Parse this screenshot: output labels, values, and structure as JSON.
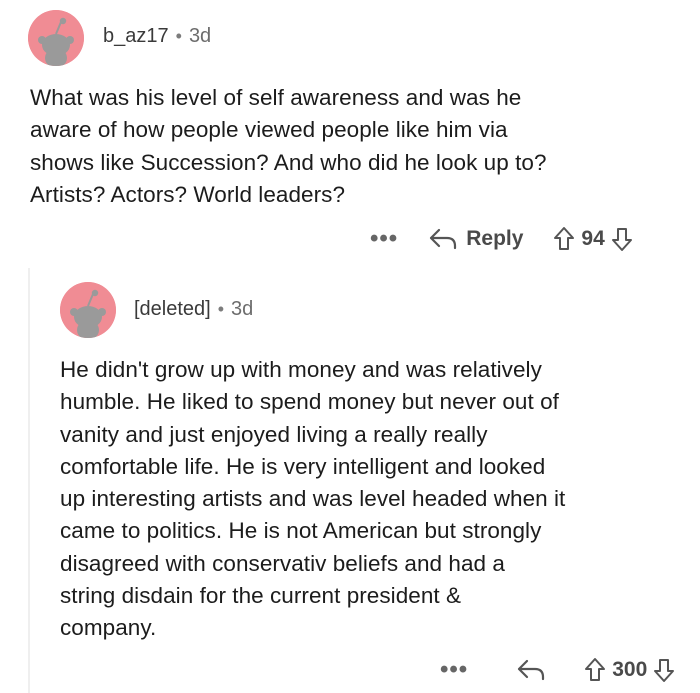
{
  "comments": [
    {
      "username": "b_az17",
      "separator": "•",
      "time": "3d",
      "lines": [
        "What was his level of self awareness and was he",
        "aware of how people viewed people like him via",
        "shows like Succession? And who did he look up to?",
        "Artists? Actors? World leaders?"
      ],
      "more_label": "•••",
      "reply_label": "Reply",
      "score": "94"
    },
    {
      "username": "[deleted]",
      "separator": "•",
      "time": "3d",
      "lines": [
        "He didn't grow up with money and was relatively",
        "humble. He liked to spend money but never out of",
        "vanity and just enjoyed living a really really",
        "comfortable life. He is very intelligent and looked",
        "up interesting artists and was level headed when it",
        "came to politics. He is not American but strongly",
        "disagreed with conservativ beliefs and had a",
        "string disdain for the current president &",
        "company."
      ],
      "more_label": "•••",
      "score": "300"
    }
  ],
  "colors": {
    "avatar": "#f08c94",
    "text": "#1c1c1c",
    "muted": "#6d6d6d",
    "thread_line": "#efefef"
  },
  "icons": [
    "snoo-avatar-icon",
    "reply-arrow-icon",
    "upvote-arrow-icon",
    "downvote-arrow-icon",
    "more-options-icon"
  ]
}
